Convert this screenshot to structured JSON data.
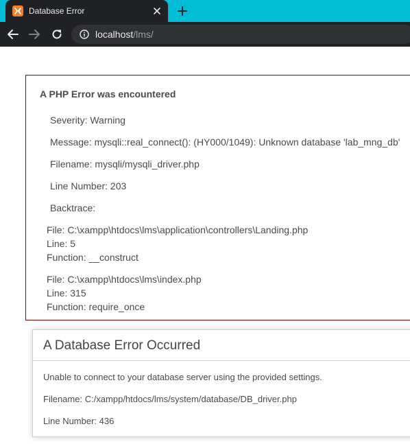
{
  "browser": {
    "tab_title": "Database Error",
    "url_host": "localhost",
    "url_path": "/lms/",
    "icons": {
      "favicon": "xampp-favicon-icon",
      "close": "close-icon",
      "new_tab": "plus-icon",
      "back": "arrow-left-icon",
      "forward": "arrow-right-icon",
      "reload": "reload-icon",
      "info": "info-icon"
    }
  },
  "php_error": {
    "heading": "A PHP Error was encountered",
    "severity": "Severity: Warning",
    "message": "Message: mysqli::real_connect(): (HY000/1049): Unknown database 'lab_mng_db'",
    "filename": "Filename: mysqli/mysqli_driver.php",
    "line_number": "Line Number: 203",
    "backtrace": "Backtrace:",
    "frames": [
      {
        "file": "File: C:\\xampp\\htdocs\\lms\\application\\controllers\\Landing.php",
        "line": "Line: 5",
        "function": "Function: __construct"
      },
      {
        "file": "File: C:\\xampp\\htdocs\\lms\\index.php",
        "line": "Line: 315",
        "function": "Function: require_once"
      }
    ]
  },
  "db_error": {
    "title": "A Database Error Occurred",
    "message": "Unable to connect to your database server using the provided settings.",
    "filename": "Filename: C:/xampp/htdocs/lms/system/database/DB_driver.php",
    "line_number": "Line Number: 436"
  },
  "colors": {
    "tab_strip": "#00bcd4",
    "chrome_dark": "#202124",
    "php_error_border": "#990000"
  }
}
